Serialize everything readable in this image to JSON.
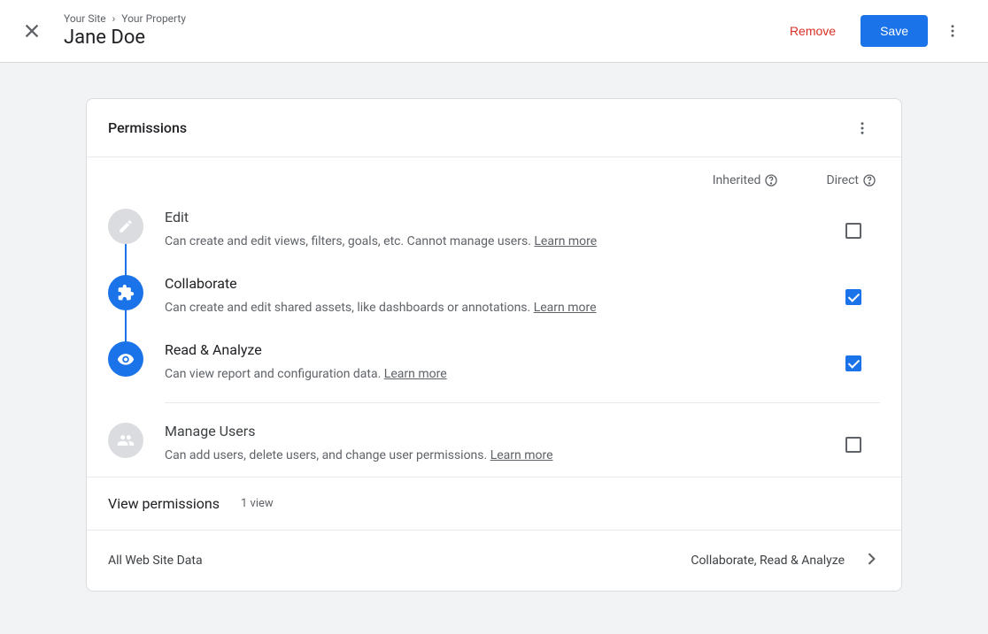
{
  "header": {
    "breadcrumb": {
      "site": "Your Site",
      "property": "Your Property"
    },
    "title": "Jane Doe",
    "remove_label": "Remove",
    "save_label": "Save"
  },
  "permissions": {
    "heading": "Permissions",
    "col_inherited": "Inherited",
    "col_direct": "Direct",
    "items": [
      {
        "title": "Edit",
        "desc": "Can create and edit views, filters, goals, etc. Cannot manage users. ",
        "learn": "Learn more",
        "checked": false,
        "active": false
      },
      {
        "title": "Collaborate",
        "desc": "Can create and edit shared assets, like dashboards or annotations. ",
        "learn": "Learn more",
        "checked": true,
        "active": true
      },
      {
        "title": "Read & Analyze",
        "desc": "Can view report and configuration data. ",
        "learn": "Learn more",
        "checked": true,
        "active": true
      },
      {
        "title": "Manage Users",
        "desc": "Can add users, delete users, and change user permissions. ",
        "learn": "Learn more",
        "checked": false,
        "active": false
      }
    ]
  },
  "view_permissions": {
    "heading": "View permissions",
    "count": "1 view",
    "rows": [
      {
        "name": "All Web Site Data",
        "perms": "Collaborate, Read & Analyze"
      }
    ]
  }
}
